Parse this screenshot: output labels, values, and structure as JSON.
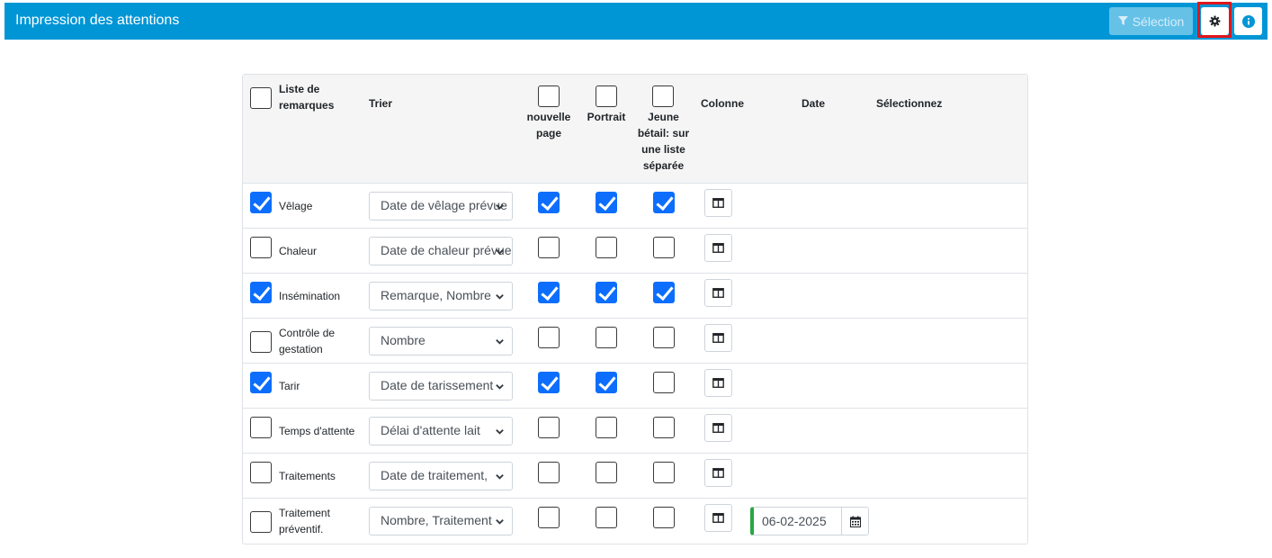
{
  "header": {
    "title": "Impression des attentions",
    "selection_label": "Sélection"
  },
  "colors": {
    "header_bg": "#0096d6",
    "checkbox_checked": "#0d6efd",
    "highlight": "#e0161c",
    "date_accent": "#28a745"
  },
  "table": {
    "headers": {
      "list": "Liste de remarques",
      "sort": "Trier",
      "new_page": "nouvelle page",
      "portrait": "Portrait",
      "young_cattle": "Jeune bétail: sur une liste séparée",
      "column": "Colonne",
      "date": "Date",
      "select": "Sélectionnez"
    },
    "header_checks": {
      "list": false,
      "new_page": false,
      "portrait": false,
      "young_cattle": false
    },
    "rows": [
      {
        "label": "Vêlage",
        "checked": true,
        "sort": "Date de vêlage prévue",
        "new_page": true,
        "portrait": true,
        "young": true,
        "date": ""
      },
      {
        "label": "Chaleur",
        "checked": false,
        "sort": "Date de chaleur prévue",
        "new_page": false,
        "portrait": false,
        "young": false,
        "date": ""
      },
      {
        "label": "Insémination",
        "checked": true,
        "sort": "Remarque, Nombre",
        "new_page": true,
        "portrait": true,
        "young": true,
        "date": ""
      },
      {
        "label": "Contrôle de gestation",
        "checked": false,
        "sort": "Nombre",
        "new_page": false,
        "portrait": false,
        "young": false,
        "date": ""
      },
      {
        "label": "Tarir",
        "checked": true,
        "sort": "Date de tarissement",
        "new_page": true,
        "portrait": true,
        "young": false,
        "date": ""
      },
      {
        "label": "Temps d'attente",
        "checked": false,
        "sort": "Délai d'attente lait",
        "new_page": false,
        "portrait": false,
        "young": false,
        "date": ""
      },
      {
        "label": "Traitements",
        "checked": false,
        "sort": "Date de traitement,",
        "new_page": false,
        "portrait": false,
        "young": false,
        "date": ""
      },
      {
        "label": "Traitement préventif.",
        "checked": false,
        "sort": "Nombre, Traitement",
        "new_page": false,
        "portrait": false,
        "young": false,
        "date": "06-02-2025"
      }
    ]
  }
}
